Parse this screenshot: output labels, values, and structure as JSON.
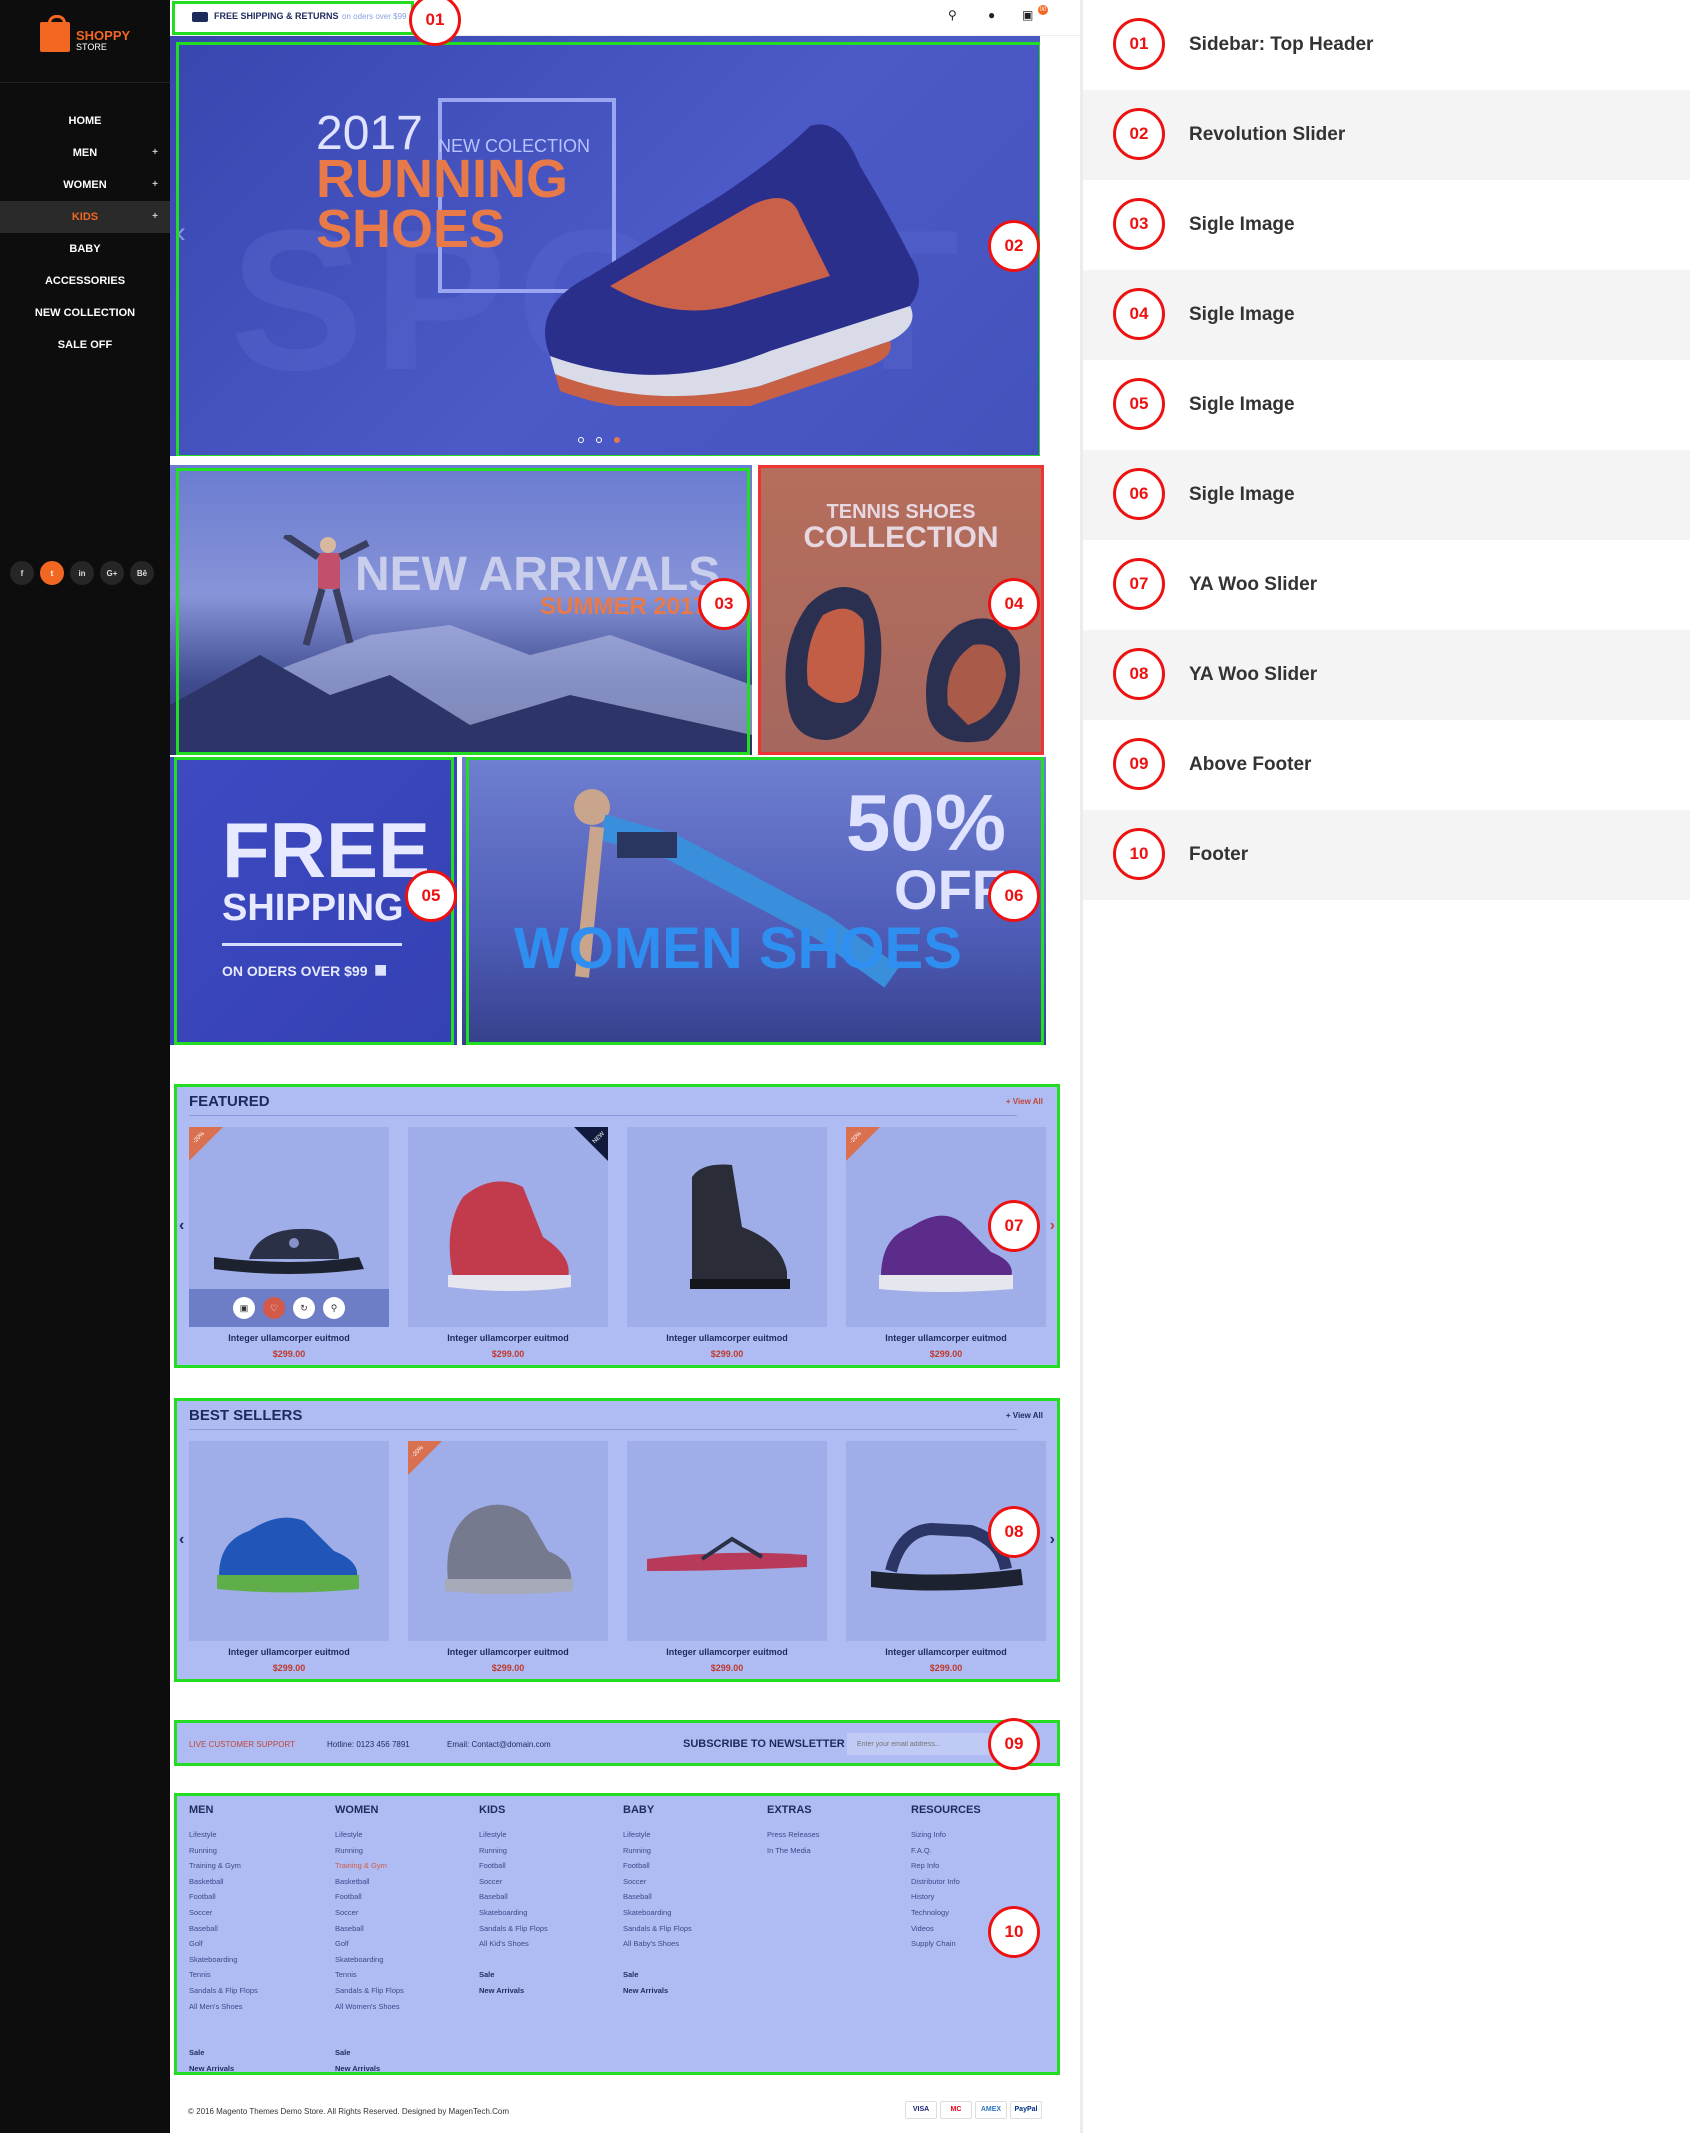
{
  "logo": {
    "name": "SHOPPY",
    "sub": "STORE"
  },
  "menu": [
    {
      "label": "HOME",
      "plus": ""
    },
    {
      "label": "MEN",
      "plus": "+"
    },
    {
      "label": "WOMEN",
      "plus": "+"
    },
    {
      "label": "KIDS",
      "plus": "+"
    },
    {
      "label": "BABY",
      "plus": ""
    },
    {
      "label": "ACCESSORIES",
      "plus": ""
    },
    {
      "label": "NEW COLLECTION",
      "plus": ""
    },
    {
      "label": "SALE OFF",
      "plus": ""
    }
  ],
  "social": [
    "f",
    "t",
    "in",
    "G+",
    "Bē"
  ],
  "topbar": {
    "shipping": "FREE SHIPPING & RETURNS",
    "shipping_sub": "on oders over $99",
    "cart_count": "00"
  },
  "hero": {
    "year": "2017",
    "collection": "NEW COLECTION",
    "title1": "RUNNING",
    "title2": "SHOES",
    "bg": "SPORT"
  },
  "img03": {
    "title": "NEW ARRIVALS",
    "sub": "SUMMER 2017"
  },
  "img04": {
    "line1": "TENNIS SHOES",
    "line2": "COLLECTION"
  },
  "img05": {
    "line1": "FREE",
    "line2": "SHIPPING",
    "line3": "ON ODERS OVER $99"
  },
  "img06": {
    "line1": "50%",
    "line2": "OFF",
    "line3": "WOMEN SHOES"
  },
  "featured": {
    "title": "FEATURED",
    "view_all": "+ View All",
    "products": [
      {
        "name": "Integer ullamcorper euitmod",
        "price": "$299.00",
        "badge": "-20%"
      },
      {
        "name": "Integer ullamcorper euitmod",
        "price": "$299.00",
        "badge": "NEW"
      },
      {
        "name": "Integer ullamcorper euitmod",
        "price": "$299.00",
        "badge": ""
      },
      {
        "name": "Integer ullamcorper euitmod",
        "price": "$299.00",
        "badge": "-20%"
      }
    ]
  },
  "bestsellers": {
    "title": "BEST SELLERS",
    "view_all": "+ View All",
    "products": [
      {
        "name": "Integer ullamcorper euitmod",
        "price": "$299.00",
        "badge": ""
      },
      {
        "name": "Integer ullamcorper euitmod",
        "price": "$299.00",
        "badge": "-20%"
      },
      {
        "name": "Integer ullamcorper euitmod",
        "price": "$299.00",
        "badge": ""
      },
      {
        "name": "Integer ullamcorper euitmod",
        "price": "$299.00",
        "badge": ""
      }
    ]
  },
  "newsletter": {
    "support": "LIVE CUSTOMER SUPPORT",
    "hotline": "Hotline: 0123 456 7891",
    "email": "Email: Contact@domain.com",
    "subscribe": "SUBSCRIBE TO NEWSLETTER",
    "placeholder": "Enter your email address..."
  },
  "footer": {
    "columns": [
      {
        "title": "MEN",
        "links": [
          "Lifestyle",
          "Running",
          "Training & Gym",
          "Basketball",
          "Football",
          "Soccer",
          "Baseball",
          "Golf",
          "Skateboarding",
          "Tennis",
          "Sandals & Flip Flops",
          "All Men's Shoes",
          "",
          "",
          "Sale",
          "New Arrivals"
        ]
      },
      {
        "title": "WOMEN",
        "links": [
          "Lifestyle",
          "Running",
          "Training & Gym",
          "Basketball",
          "Football",
          "Soccer",
          "Baseball",
          "Golf",
          "Skateboarding",
          "Tennis",
          "Sandals & Flip Flops",
          "All Women's Shoes",
          "",
          "",
          "Sale",
          "New Arrivals"
        ]
      },
      {
        "title": "KIDS",
        "links": [
          "Lifestyle",
          "Running",
          "Football",
          "Soccer",
          "Baseball",
          "Skateboarding",
          "Sandals & Flip Flops",
          "All Kid's Shoes",
          "",
          "Sale",
          "New Arrivals"
        ]
      },
      {
        "title": "BABY",
        "links": [
          "Lifestyle",
          "Running",
          "Football",
          "Soccer",
          "Baseball",
          "Skateboarding",
          "Sandals & Flip Flops",
          "All Baby's Shoes",
          "",
          "Sale",
          "New Arrivals"
        ]
      },
      {
        "title": "EXTRAS",
        "links": [
          "Press Releases",
          "In The Media"
        ]
      },
      {
        "title": "RESOURCES",
        "links": [
          "Sizing Info",
          "F.A.Q.",
          "Rep Info",
          "Distributor Info",
          "History",
          "Technology",
          "Videos",
          "Supply Chain"
        ]
      }
    ],
    "copyright": "© 2016 Magento Themes Demo Store. All Rights Reserved. Designed by MagenTech.Com",
    "payments": [
      "VISA",
      "MC",
      "AMEX",
      "PayPal"
    ]
  },
  "legend": [
    {
      "num": "01",
      "label": "Sidebar: Top Header"
    },
    {
      "num": "02",
      "label": "Revolution Slider"
    },
    {
      "num": "03",
      "label": "Sigle Image"
    },
    {
      "num": "04",
      "label": "Sigle Image"
    },
    {
      "num": "05",
      "label": "Sigle Image"
    },
    {
      "num": "06",
      "label": "Sigle Image"
    },
    {
      "num": "07",
      "label": "YA Woo Slider"
    },
    {
      "num": "08",
      "label": "YA Woo Slider"
    },
    {
      "num": "09",
      "label": "Above Footer"
    },
    {
      "num": "10",
      "label": "Footer"
    }
  ],
  "colors": {
    "accent": "#f26722",
    "annot_green": "#22dd22",
    "annot_red": "#ee1111",
    "overlay": "#5566dd"
  }
}
